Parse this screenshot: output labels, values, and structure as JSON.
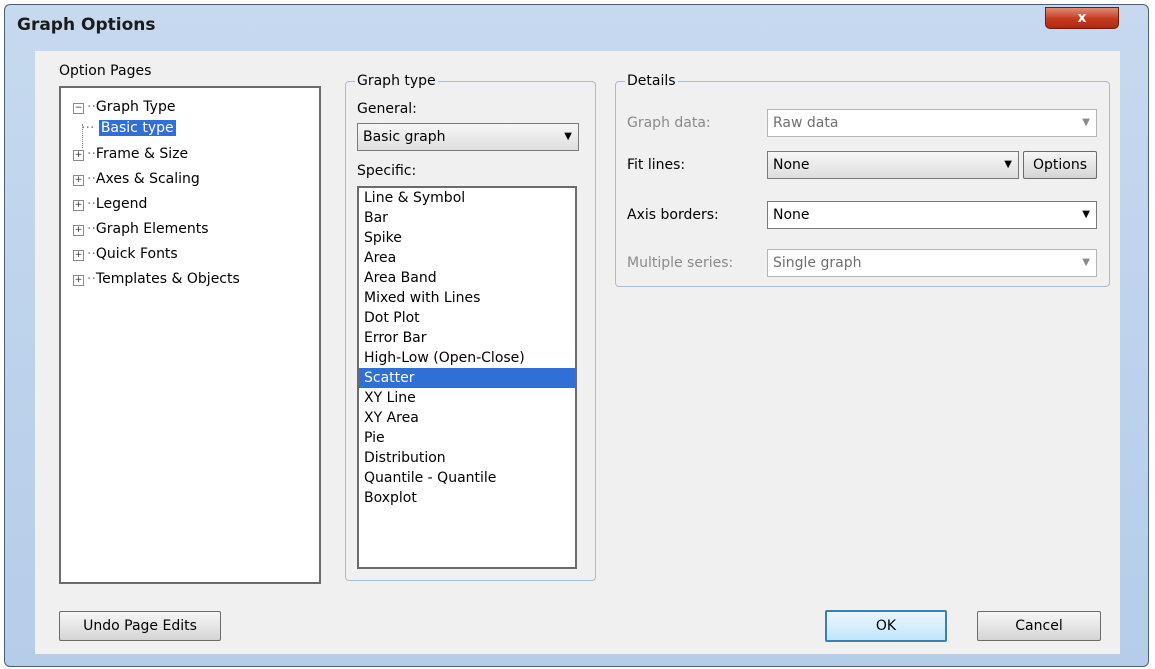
{
  "window": {
    "title": "Graph Options",
    "close_label": "x"
  },
  "option_pages": {
    "label": "Option Pages",
    "items": [
      {
        "label": "Graph Type",
        "toggle": "−"
      },
      {
        "label": "Basic type"
      },
      {
        "label": "Frame & Size",
        "toggle": "+"
      },
      {
        "label": "Axes & Scaling",
        "toggle": "+"
      },
      {
        "label": "Legend",
        "toggle": "+"
      },
      {
        "label": "Graph Elements",
        "toggle": "+"
      },
      {
        "label": "Quick Fonts",
        "toggle": "+"
      },
      {
        "label": "Templates & Objects",
        "toggle": "+"
      }
    ]
  },
  "graph_type": {
    "label": "Graph type",
    "general_label": "General:",
    "general_value": "Basic graph",
    "specific_label": "Specific:",
    "specific_items": [
      "Line & Symbol",
      "Bar",
      "Spike",
      "Area",
      "Area Band",
      "Mixed with Lines",
      "Dot Plot",
      "Error Bar",
      "High-Low (Open-Close)",
      "Scatter",
      "XY Line",
      "XY Area",
      "Pie",
      "Distribution",
      "Quantile - Quantile",
      "Boxplot"
    ],
    "selected": "Scatter"
  },
  "details": {
    "label": "Details",
    "graph_data_label": "Graph data:",
    "graph_data_value": "Raw data",
    "fit_lines_label": "Fit lines:",
    "fit_lines_value": "None",
    "options_button": "Options",
    "axis_borders_label": "Axis borders:",
    "axis_borders_value": "None",
    "multiple_series_label": "Multiple series:",
    "multiple_series_value": "Single graph"
  },
  "buttons": {
    "undo": "Undo Page Edits",
    "ok": "OK",
    "cancel": "Cancel"
  },
  "icons": {
    "dropdown": "chevron-down-icon",
    "close": "close-icon",
    "expand": "plus-box-icon",
    "collapse": "minus-box-icon"
  },
  "colors": {
    "selection": "#2f6fd6",
    "frame": "#b5cde9",
    "close": "#c43a1e"
  }
}
